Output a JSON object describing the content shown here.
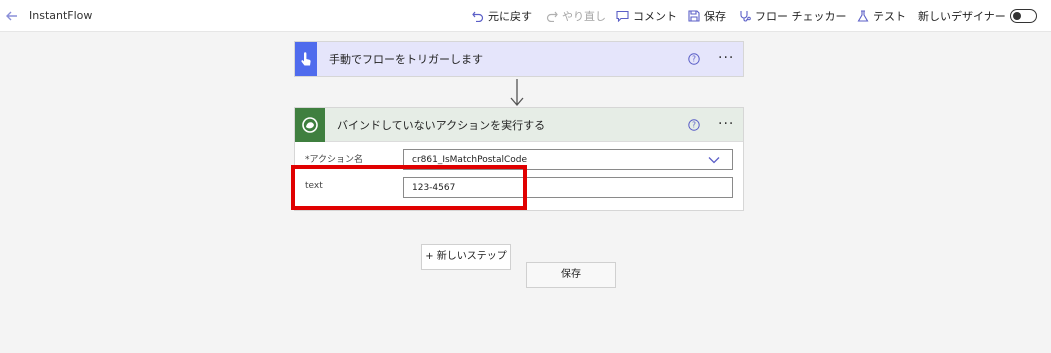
{
  "app": {
    "title": "InstantFlow"
  },
  "toolbar": {
    "undo": "元に戻す",
    "redo": "やり直し",
    "comment": "コメント",
    "save": "保存",
    "flow_checker": "フロー チェッカー",
    "test": "テスト",
    "new_designer": "新しいデザイナー"
  },
  "trigger": {
    "title": "手動でフローをトリガーします",
    "help": "?",
    "more": "···"
  },
  "action": {
    "title": "バインドしていないアクションを実行する",
    "help": "?",
    "more": "···",
    "fields": {
      "action_name_label": "*アクション名",
      "action_name_value": "cr861_IsMatchPostalCode",
      "text_label": "text",
      "text_value": "123-4567"
    }
  },
  "buttons": {
    "new_step": "+ 新しいステップ",
    "save": "保存"
  },
  "colors": {
    "trigger_accent": "#4f6bed",
    "action_accent": "#3f7f3f",
    "highlight": "#e00000"
  }
}
